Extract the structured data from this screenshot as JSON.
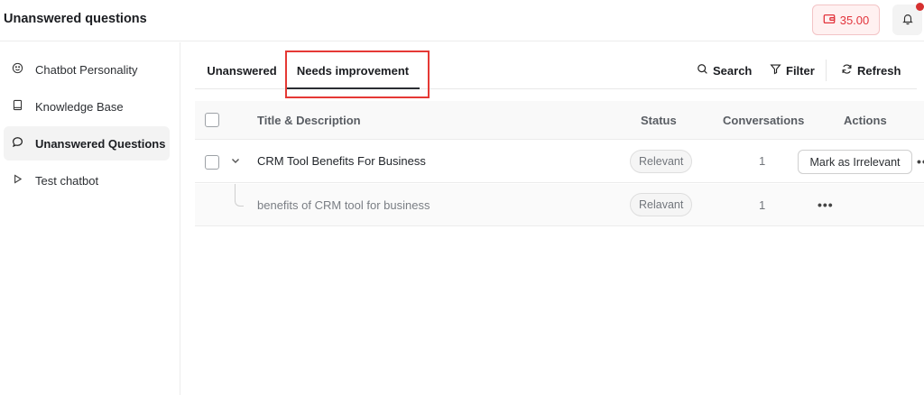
{
  "header": {
    "title": "Unanswered questions",
    "credits": "35.00",
    "credit_icon": "wallet-icon",
    "notification_icon": "bell-icon"
  },
  "sidebar": {
    "items": [
      {
        "label": "Chatbot Personality",
        "icon": "smiley-icon",
        "active": false
      },
      {
        "label": "Knowledge Base",
        "icon": "book-icon",
        "active": false
      },
      {
        "label": "Unanswered Questions",
        "icon": "speech-bubble-icon",
        "active": true
      },
      {
        "label": "Test chatbot",
        "icon": "play-icon",
        "active": false
      }
    ]
  },
  "tabs": [
    {
      "label": "Unanswered",
      "active": false
    },
    {
      "label": "Needs improvement",
      "active": true
    }
  ],
  "toolbar": {
    "search_label": "Search",
    "filter_label": "Filter",
    "refresh_label": "Refresh"
  },
  "table": {
    "columns": [
      "Title & Description",
      "Status",
      "Conversations",
      "Actions"
    ],
    "rows": [
      {
        "title": "CRM Tool Benefits For Business",
        "status": "Relevant",
        "conversations": "1",
        "action": "Mark as Irrelevant",
        "more": "•••",
        "children": [
          {
            "title": "benefits of CRM tool for business",
            "status": "Relavant",
            "conversations": "1",
            "more": "•••"
          }
        ]
      }
    ]
  },
  "colors": {
    "credit_accent": "#e2343c",
    "highlight_box": "#e53935",
    "active_tab_underline": "#2b2d33"
  }
}
